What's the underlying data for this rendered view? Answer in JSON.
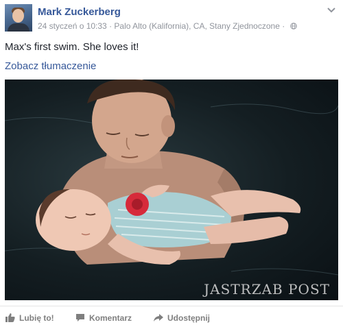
{
  "post": {
    "author": "Mark Zuckerberg",
    "date": "24 styczeń o 10:33",
    "separator": "·",
    "location": "Palo Alto (Kalifornia), CA, Stany Zjednoczone",
    "separator2": "·",
    "audience_icon": "globe-icon",
    "options_icon": "chevron-down-icon",
    "text": "Max's first swim. She loves it!",
    "translate_label": "Zobacz tłumaczenie",
    "photo_watermark": "JASTRZAB POST"
  },
  "actions": {
    "like_label": "Lubię to!",
    "comment_label": "Komentarz",
    "share_label": "Udostępnij"
  },
  "colors": {
    "link": "#365899",
    "meta": "#90949c",
    "action": "#7f7f7f"
  }
}
